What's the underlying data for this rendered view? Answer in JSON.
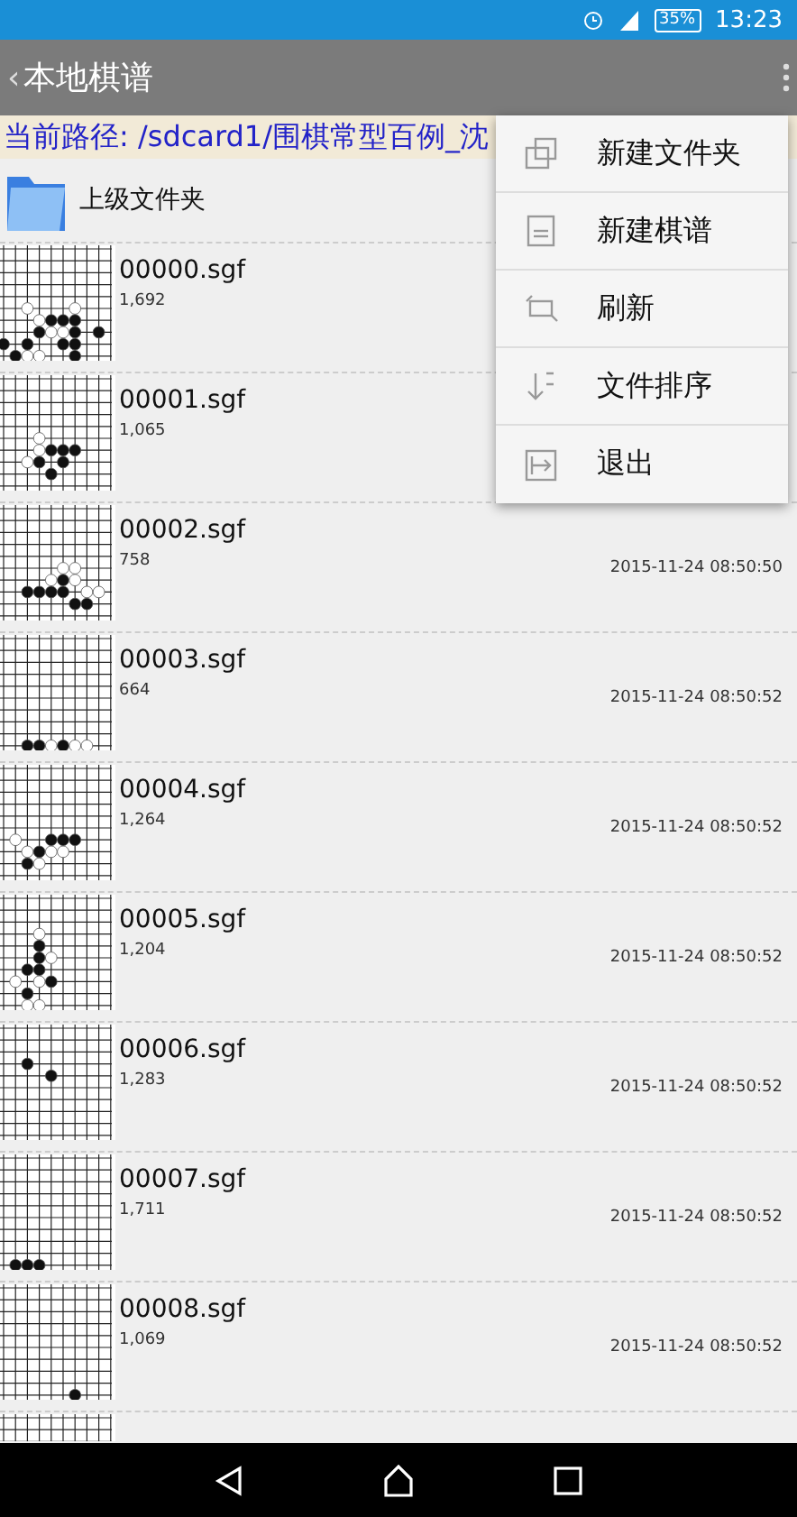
{
  "status_bar": {
    "battery": "35%",
    "time": "13:23"
  },
  "toolbar": {
    "back": "‹",
    "title": "本地棋谱"
  },
  "path": "当前路径: /sdcard1/围棋常型百例_沈",
  "parent_folder": "上级文件夹",
  "files": [
    {
      "name": "00000.sgf",
      "size": "1,692"
    },
    {
      "name": "00001.sgf",
      "size": "1,065"
    },
    {
      "name": "00002.sgf",
      "size": "758",
      "date": "2015-11-24 08:50:50"
    },
    {
      "name": "00003.sgf",
      "size": "664",
      "date": "2015-11-24 08:50:52"
    },
    {
      "name": "00004.sgf",
      "size": "1,264",
      "date": "2015-11-24 08:50:52"
    },
    {
      "name": "00005.sgf",
      "size": "1,204",
      "date": "2015-11-24 08:50:52"
    },
    {
      "name": "00006.sgf",
      "size": "1,283",
      "date": "2015-11-24 08:50:52"
    },
    {
      "name": "00007.sgf",
      "size": "1,711",
      "date": "2015-11-24 08:50:52"
    },
    {
      "name": "00008.sgf",
      "size": "1,069",
      "date": "2015-11-24 08:50:52"
    }
  ],
  "menu": [
    {
      "kind": "folder",
      "label": "新建文件夹"
    },
    {
      "kind": "new",
      "label": "新建棋谱"
    },
    {
      "kind": "refresh",
      "label": "刷新"
    },
    {
      "kind": "sort",
      "label": "文件排序"
    },
    {
      "kind": "exit",
      "label": "退出"
    }
  ]
}
